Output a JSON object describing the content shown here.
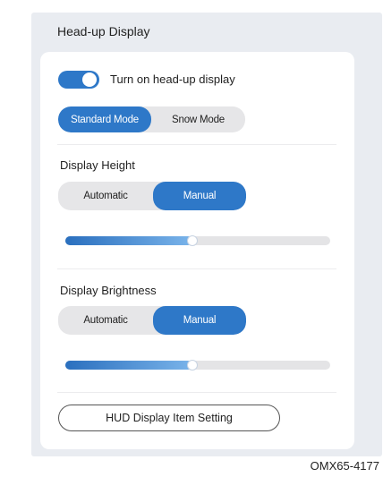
{
  "header": {
    "title": "Head-up Display"
  },
  "hud_toggle": {
    "label": "Turn on head-up display",
    "on": true
  },
  "mode": {
    "options": [
      "Standard Mode",
      "Snow Mode"
    ],
    "selected": "Standard Mode"
  },
  "display_height": {
    "title": "Display Height",
    "options": [
      "Automatic",
      "Manual"
    ],
    "selected": "Manual",
    "slider_level": 0.48
  },
  "display_brightness": {
    "title": "Display Brightness",
    "options": [
      "Automatic",
      "Manual"
    ],
    "selected": "Manual",
    "slider_level": 0.48
  },
  "item_setting_button": {
    "label": "HUD Display Item Setting"
  },
  "figure_code": "OMX65-4177",
  "colors": {
    "accent": "#2e78c8",
    "panel": "#e9ecf1",
    "card": "#ffffff"
  }
}
